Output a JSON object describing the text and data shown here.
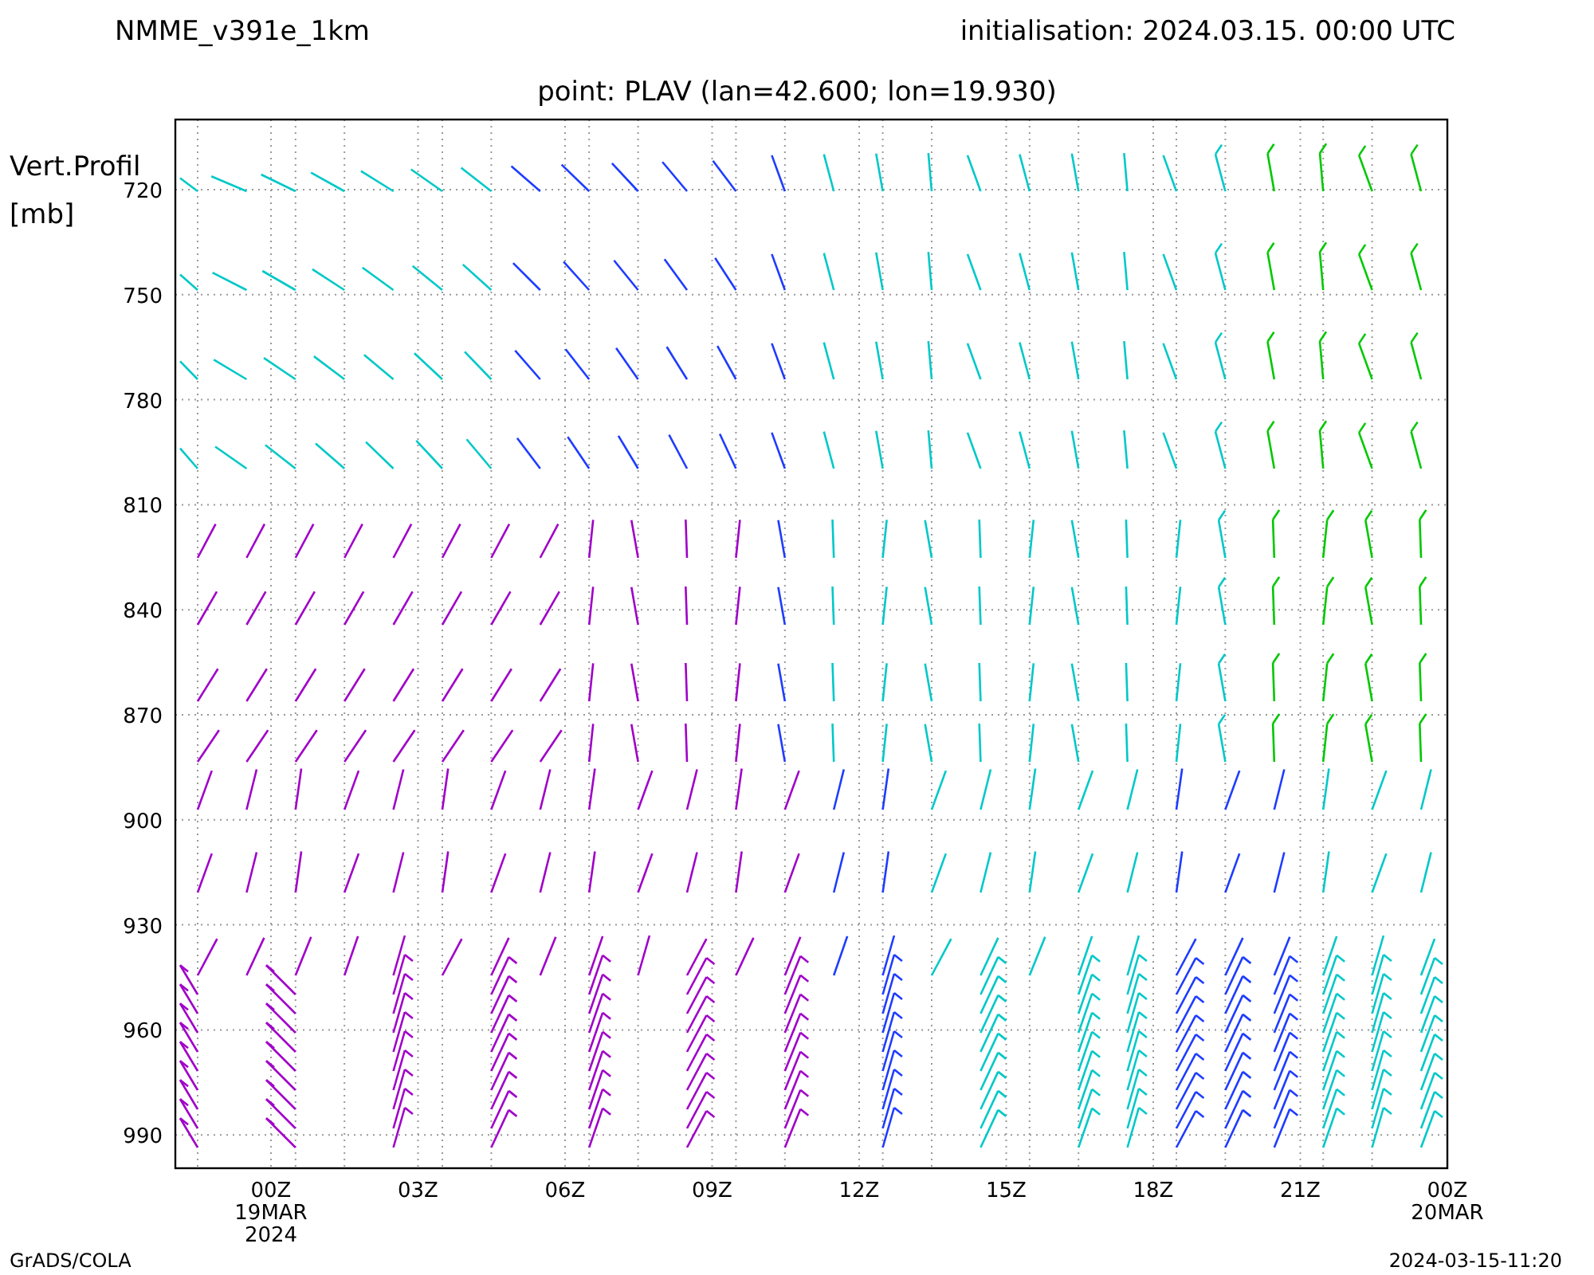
{
  "title_left": "NMME_v391e_1km",
  "title_right": "initialisation:  2024.03.15.  00:00  UTC",
  "subtitle": "point:  PLAV (lan=42.600; lon=19.930)",
  "y_axis_label": [
    "Vert.Profil",
    "[mb]"
  ],
  "y_ticks": [
    "720",
    "750",
    "780",
    "810",
    "840",
    "870",
    "900",
    "930",
    "960",
    "990"
  ],
  "x_ticks": [
    {
      "label": "00Z",
      "date": "19MAR",
      "year": "2024"
    },
    {
      "label": "03Z"
    },
    {
      "label": "06Z"
    },
    {
      "label": "09Z"
    },
    {
      "label": "12Z"
    },
    {
      "label": "15Z"
    },
    {
      "label": "18Z"
    },
    {
      "label": "21Z"
    },
    {
      "label": "00Z",
      "date": "20MAR"
    }
  ],
  "footer_left": "GrADS/COLA",
  "footer_right": "2024-03-15-11:20"
}
